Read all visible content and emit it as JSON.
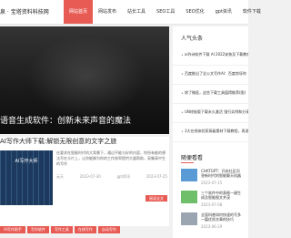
{
  "header": {
    "logo": "泉 · 宝塔资料科技网",
    "nav": [
      "网站首页",
      "网站发布",
      "站长工具",
      "SEO工具",
      "SEO优化",
      "gpt资讯",
      "软件下载"
    ],
    "active_index": 0
  },
  "hero": {
    "caption": "语音生成软件：创新未来声音的魔法"
  },
  "hot": {
    "heading": "人气头条",
    "items": [
      "ai作诗软件下载 AI 2022安装及下载教程",
      "百度推出了全公文写作AI：百度惊讶你",
      "除了微医，这些下载工具值得推荐(图)",
      "UN终极版下载永久激活 强行实例和分享",
      "3大在线体验家高级素材下载教程，再说不一"
    ]
  },
  "post": {
    "title": "AI写作大师下载:解锁无限创意的文字之旅",
    "thumb_caption": "AI写作大师",
    "excerpt": "在要求在智能时代的大背景下，通过不能与好的内容，你所有能的想法写在卡片上，让你能够为你的工作效率提供大量帮助，采集高中生的写作",
    "meta": [
      "云天",
      "2023-07-30",
      "gpt资讯",
      "2023-07-25"
    ],
    "read_more": "阅读全文"
  },
  "tags": [
    "AI写作助手",
    "写作软件",
    "写作工具",
    "在线写作",
    "自动写作"
  ],
  "recommend": {
    "heading": "随便看看",
    "items": [
      {
        "title": "CHATGPT：开启社区问答新时代的智能聊天机器",
        "date": "2023-07-15",
        "thumb_color": "#5b9bd5"
      },
      {
        "title": "三个软件中的表格一键生成及智能图文并茂",
        "date": "2023-07-08",
        "thumb_color": "#6fbf6a"
      },
      {
        "title": "全面科普如何快速的写多一篇优质文章的技巧",
        "date": "2023-06-29",
        "thumb_color": "#9aa5b1"
      }
    ]
  }
}
